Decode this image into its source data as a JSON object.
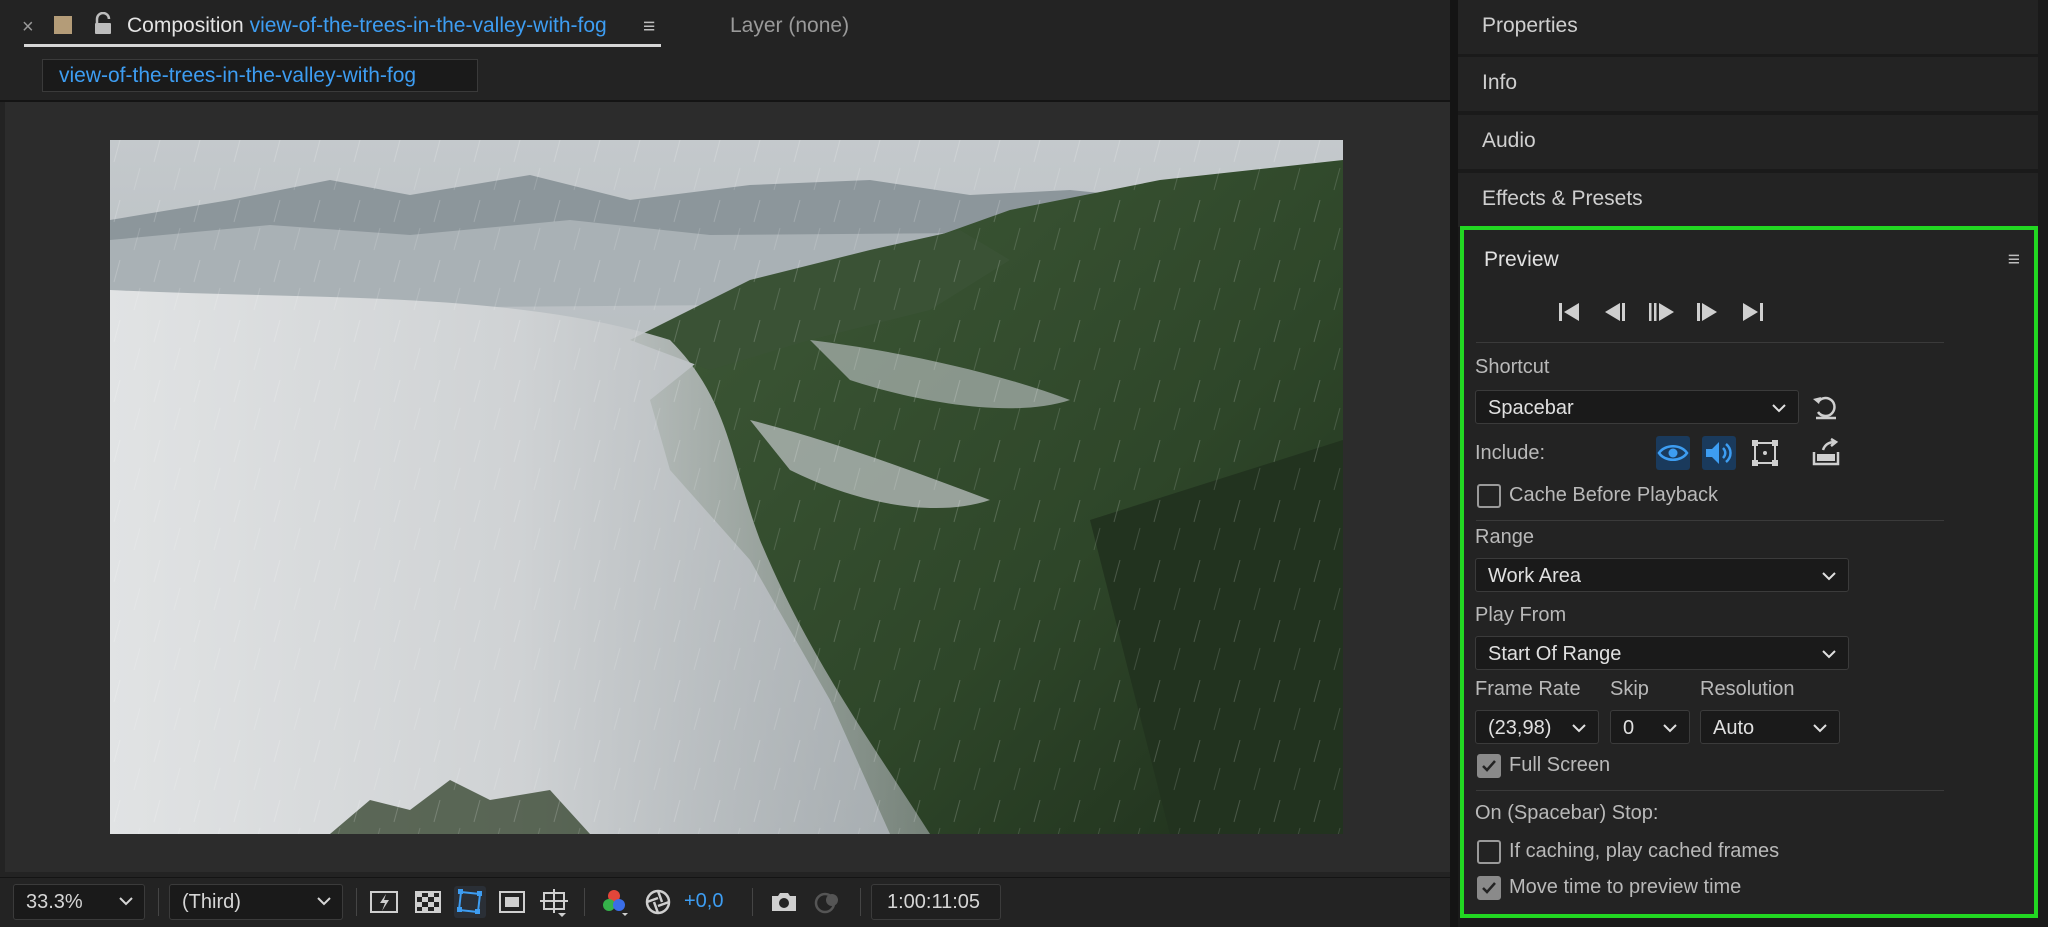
{
  "composition_tab": {
    "close": "×",
    "prefix": "Composition",
    "name": "view-of-the-trees-in-the-valley-with-fog",
    "menu": "≡",
    "layer_tab": "Layer (none)"
  },
  "breadcrumb": "view-of-the-trees-in-the-valley-with-fog",
  "viewer_toolbar": {
    "zoom": "33.3%",
    "resolution": "(Third)",
    "exposure": "+0,0",
    "timecode": "1:00:11:05"
  },
  "right_panels": [
    "Properties",
    "Info",
    "Audio",
    "Effects & Presets"
  ],
  "preview": {
    "title": "Preview",
    "menu": "≡",
    "shortcut_label": "Shortcut",
    "shortcut_value": "Spacebar",
    "include_label": "Include:",
    "cache_before_playback": "Cache Before Playback",
    "cache_before_playback_checked": false,
    "range_label": "Range",
    "range_value": "Work Area",
    "play_from_label": "Play From",
    "play_from_value": "Start Of Range",
    "frame_rate_label": "Frame Rate",
    "frame_rate_value": "(23,98)",
    "skip_label": "Skip",
    "skip_value": "0",
    "resolution_label": "Resolution",
    "resolution_value": "Auto",
    "full_screen": "Full Screen",
    "full_screen_checked": true,
    "stop_label": "On (Spacebar) Stop:",
    "if_caching": "If caching, play cached frames",
    "if_caching_checked": false,
    "move_time": "Move time to preview time",
    "move_time_checked": true
  },
  "colors": {
    "accent_blue": "#3d9df2",
    "highlight_green": "#22d722",
    "panel_bg": "#232323"
  }
}
